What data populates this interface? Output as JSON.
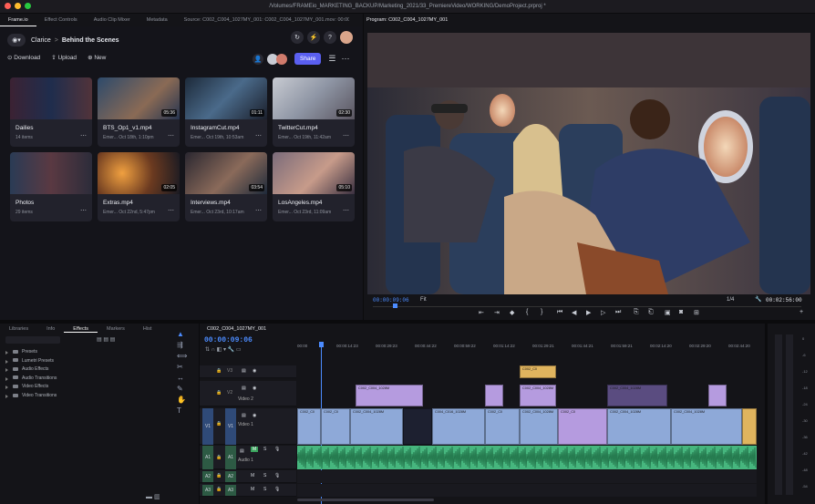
{
  "window": {
    "title": "/Volumes/FRAMEio_MARKETING_BACKUP/Marketing_2021/33_PremiereVideo/WORKING/DemoProject.prproj *"
  },
  "left_tabs": [
    "Frame.io",
    "Effect Controls",
    "Audio Clip Mixer",
    "Metadata",
    "Source: C002_C004_1027MY_001: C002_C004_1027MY_001.mov: 00:00:40:1"
  ],
  "frameio": {
    "breadcrumb_root": "Clarice",
    "breadcrumb_sep": ">",
    "breadcrumb_current": "Behind the Scenes",
    "actions": {
      "download": "Download",
      "upload": "Upload",
      "new": "New",
      "share": "Share"
    },
    "folders": [
      {
        "name": "Dailies",
        "count": "14 items"
      },
      {
        "name": "Photos",
        "count": "29 items"
      }
    ],
    "assets": [
      {
        "title": "BTS_Op1_v1.mp4",
        "meta": "Emer... Oct 18th, 1:10pm",
        "duration": "05:36"
      },
      {
        "title": "InstagramCut.mp4",
        "meta": "Emer... Oct 19th, 10:53am",
        "duration": "01:11"
      },
      {
        "title": "TwitterCut.mp4",
        "meta": "Emer... Oct 19th, 11:42am",
        "duration": "02:30"
      },
      {
        "title": "Extras.mp4",
        "meta": "Emer... Oct 22nd, 5:47pm",
        "duration": "02:05"
      },
      {
        "title": "Interviews.mp4",
        "meta": "Emer... Oct 23rd, 10:17am",
        "duration": "03:54"
      },
      {
        "title": "LosAngeles.mp4",
        "meta": "Emer... Oct 23rd, 11:09am",
        "duration": "05:10"
      }
    ]
  },
  "program": {
    "tab": "Program: C002_C004_1027MY_001",
    "timecode": "00:00:09:06",
    "fit": "Fit",
    "fraction": "1/4",
    "duration": "00:02:56:00"
  },
  "effects": {
    "tabs": [
      "Libraries",
      "Info",
      "Effects",
      "Markers",
      "Hist"
    ],
    "active": "Effects",
    "folders": [
      "Presets",
      "Lumetri Presets",
      "Audio Effects",
      "Audio Transitions",
      "Video Effects",
      "Video Transitions"
    ]
  },
  "timeline": {
    "tab": "C002_C004_1027MY_001",
    "timecode": "00:00:09:06",
    "ruler": [
      "00:00",
      "00:00:14:23",
      "00:00:29:23",
      "00:00:44:22",
      "00:00:59:22",
      "00:01:14:22",
      "00:01:29:21",
      "00:01:44:21",
      "00:01:59:21",
      "00:02:14:20",
      "00:02:29:20",
      "00:02:44:20"
    ],
    "tracks": {
      "v3": "V3",
      "v2": "V2",
      "v1": "V1",
      "video2": "Video 2",
      "video1": "Video 1",
      "a1": "A1",
      "a2": "A2",
      "a3": "A3",
      "audio1": "Audio 1",
      "m": "M",
      "s": "S"
    },
    "clip_label": "C002_C004_1028M",
    "clip_short": "C002_C0",
    "clip_v1b": "C004_C016_1028M"
  },
  "meter": {
    "ticks": [
      "0",
      "-6",
      "-12",
      "-18",
      "-24",
      "-30",
      "-36",
      "-42",
      "-48",
      "-54"
    ]
  },
  "colors": {
    "accent": "#4c8cff",
    "share": "#5a5ff0",
    "video": "#8ea9d8",
    "purple": "#b59bdf",
    "audio": "#5cc48f"
  }
}
